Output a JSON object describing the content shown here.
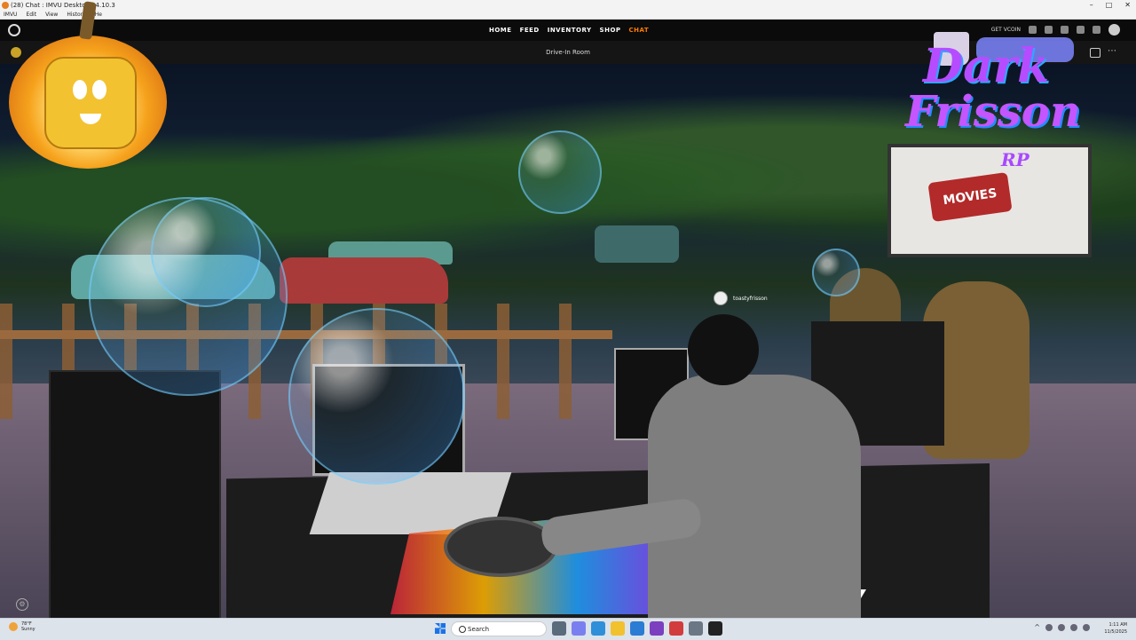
{
  "window": {
    "title": "(28) Chat : IMVU Desktop 14.10.3",
    "controls": [
      "–",
      "□",
      "✕"
    ]
  },
  "menu": [
    "IMVU",
    "Edit",
    "View",
    "History",
    "He"
  ],
  "nav": {
    "links": [
      "HOME",
      "FEED",
      "INVENTORY",
      "SHOP",
      "CHAT"
    ],
    "active": "CHAT",
    "vcoin_label": "GET VCOIN"
  },
  "room": {
    "title": "Drive-In Room",
    "username": "toastyfrisson"
  },
  "scene": {
    "screen_sign": "MOVIES",
    "logo_line1": "Dark",
    "logo_line2": "Frisson",
    "logo_line3": "RP"
  },
  "taskbar": {
    "weather_temp": "78°F",
    "weather_desc": "Sunny",
    "search_placeholder": "Search",
    "time": "1:11 AM",
    "date": "11/5/2025"
  },
  "colors": {
    "accent": "#ff7b00",
    "nav_bg": "#0b0b0b"
  }
}
